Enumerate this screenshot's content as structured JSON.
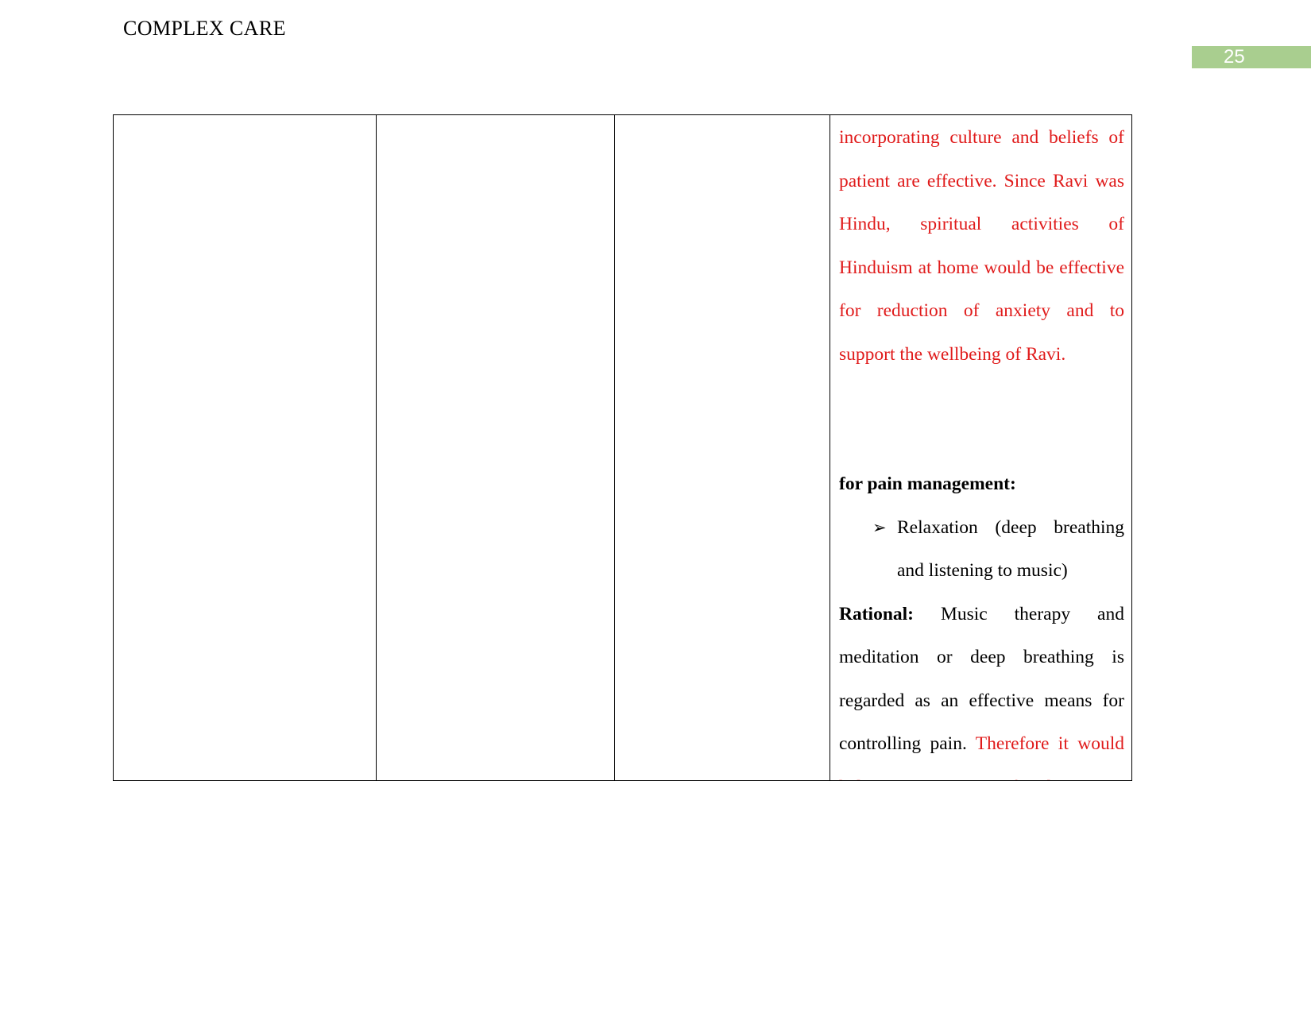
{
  "header": {
    "title": "COMPLEX CARE",
    "page_number": "25",
    "badge_color": "#A9CE8F"
  },
  "colors": {
    "red_text": "#E01B1B",
    "black_text": "#000000",
    "table_border": "#000000"
  },
  "table": {
    "columns": [
      {
        "name": "column-1",
        "content": ""
      },
      {
        "name": "column-2",
        "content": ""
      },
      {
        "name": "column-3",
        "content": ""
      },
      {
        "name": "column-4",
        "content": "interventions-and-rationale"
      }
    ],
    "column4": {
      "red_paragraph": {
        "lines": [
          "incorporating culture and beliefs of",
          "patient are effective. Since Ravi was",
          "Hindu, spiritual activities of",
          "Hinduism at home would be effective",
          "for reduction of anxiety and to",
          "support the wellbeing of Ravi."
        ],
        "full_text": "incorporating culture and beliefs of patient are effective. Since Ravi was Hindu, spiritual activities of Hinduism at home would be effective for reduction of anxiety and to support the wellbeing of Ravi."
      },
      "heading": "for pain management:",
      "bullet": {
        "glyph": "➢",
        "lines": [
          "Relaxation (deep breathing",
          "and listening to music)"
        ],
        "full_text": "Relaxation (deep breathing and listening to music)"
      },
      "rational": {
        "label": "Rational:",
        "black_lines": [
          " Music therapy and",
          "meditation or deep breathing is",
          "regarded as an effective means for",
          "controlling pain. "
        ],
        "black_text": "Music therapy and meditation or deep breathing is regarded as an effective means for controlling pain.",
        "red_text": "Therefore it would help to manage pain for the patient",
        "red_line_1": "Therefore it would",
        "red_line_2": "help to manage pain for the patient"
      }
    }
  }
}
